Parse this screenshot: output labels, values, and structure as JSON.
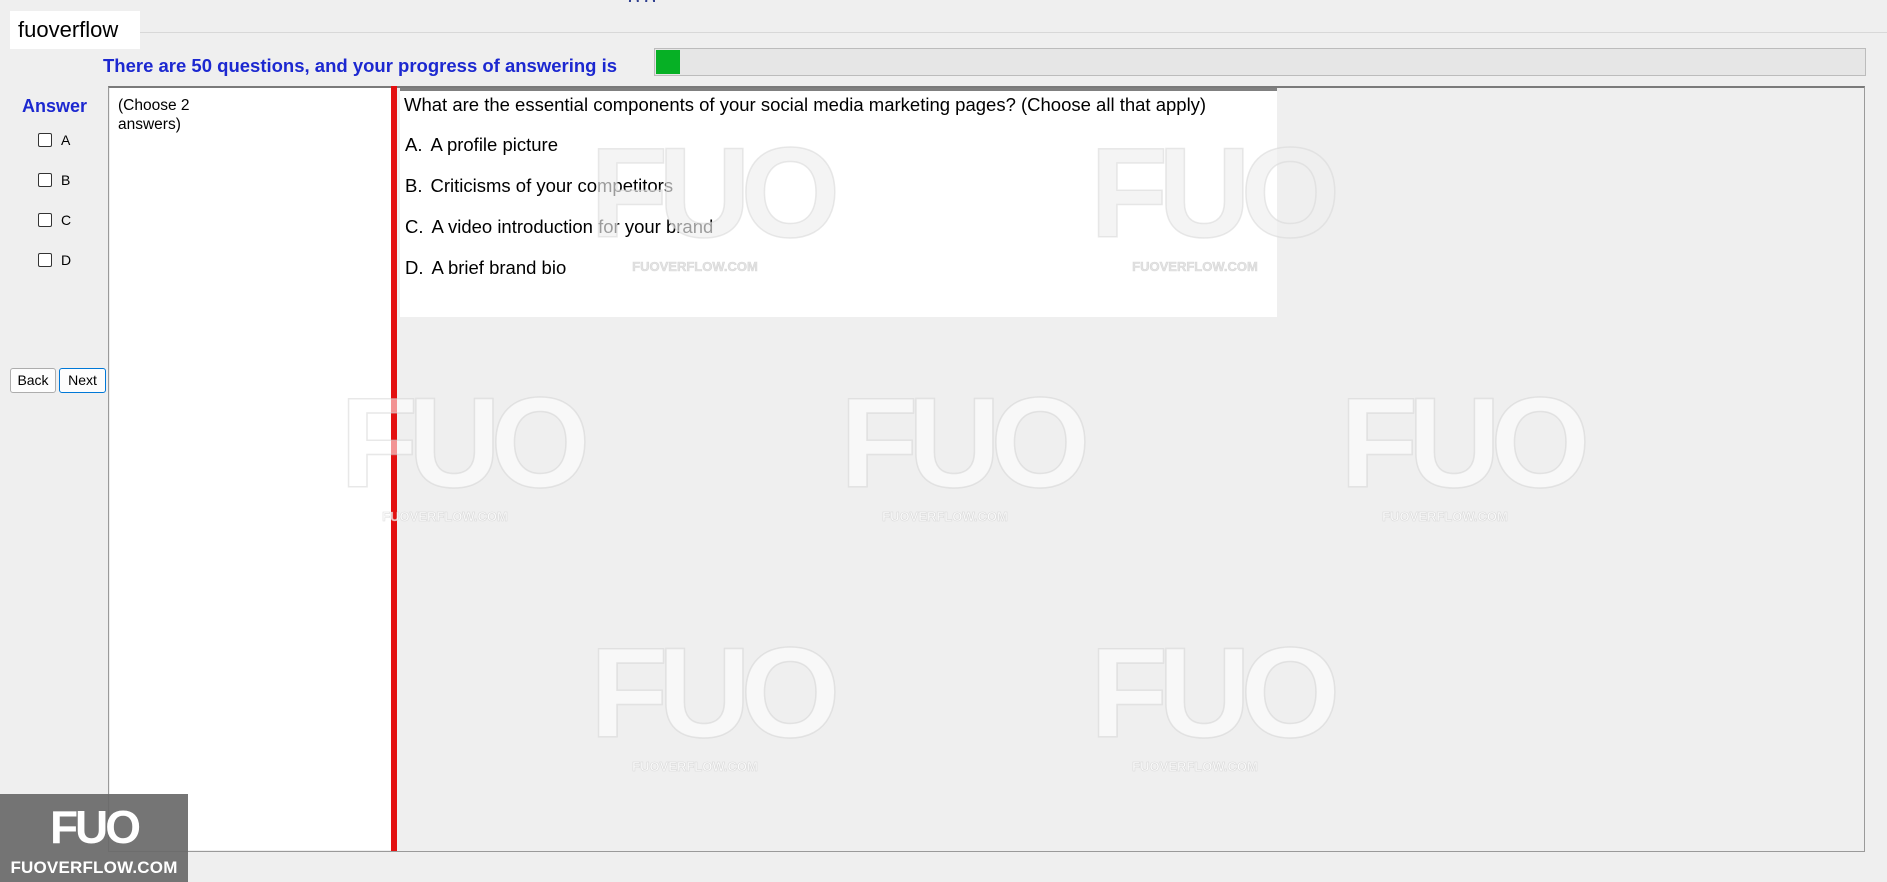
{
  "app": {
    "brand_tab": "fuoverflow"
  },
  "progress": {
    "label": "There are 50 questions, and your progress of answering is",
    "fraction": 0.02
  },
  "answer_panel": {
    "title": "Answer",
    "choices": [
      {
        "label": "A",
        "checked": false
      },
      {
        "label": "B",
        "checked": false
      },
      {
        "label": "C",
        "checked": false
      },
      {
        "label": "D",
        "checked": false
      }
    ],
    "back_label": "Back",
    "next_label": "Next"
  },
  "hint": {
    "text": "(Choose 2 answers)"
  },
  "question": {
    "stem": "What are the essential components of your social media marketing pages? (Choose all that apply)",
    "options": [
      {
        "letter": "A.",
        "text": "A profile picture"
      },
      {
        "letter": "B.",
        "text": "Criticisms of your competitors"
      },
      {
        "letter": "C.",
        "text": "A video introduction for your brand"
      },
      {
        "letter": "D.",
        "text": "A brief brand bio"
      }
    ]
  },
  "watermark": {
    "logo": "FUO",
    "text": "FUOVERFLOW.COM"
  },
  "badge": {
    "logo": "FUO",
    "text": "FUOVERFLOW.COM"
  },
  "colors": {
    "accent_text": "#1c28d0",
    "progress_fill": "#06b025",
    "splitter": "#e31010",
    "background": "#efefef"
  }
}
